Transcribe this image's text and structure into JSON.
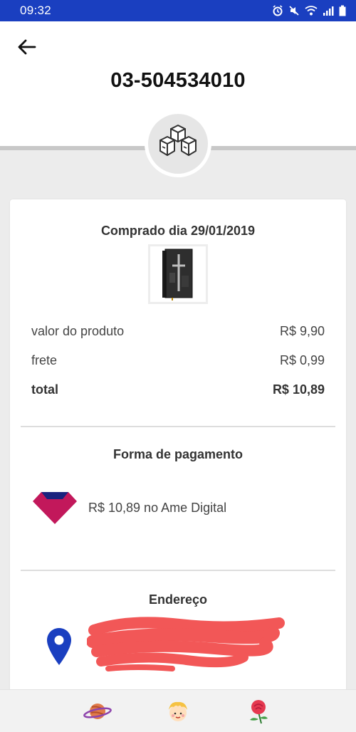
{
  "status_bar": {
    "time": "09:32",
    "icons": [
      "alarm-icon",
      "mute-icon",
      "wifi-icon",
      "signal-icon",
      "battery-icon"
    ]
  },
  "header": {
    "order_number": "03-504534010",
    "back_icon": "arrow-left-icon",
    "badge_icon": "boxes-icon"
  },
  "order": {
    "purchase_date": "Comprado dia 29/01/2019",
    "product_image": "book-cover-thumbnail",
    "rows": [
      {
        "label": "valor do produto",
        "value": "R$ 9,90"
      },
      {
        "label": "frete",
        "value": "R$ 0,99"
      },
      {
        "label": "total",
        "value": "R$ 10,89"
      }
    ]
  },
  "payment": {
    "title": "Forma de pagamento",
    "description": "R$ 10,89 no Ame Digital",
    "icon": "ame-digital-logo"
  },
  "address": {
    "title": "Endereço",
    "icon": "map-pin-icon",
    "lines": [
      "",
      "",
      ""
    ]
  },
  "bottom_nav": {
    "items": [
      "planet-icon",
      "child-avatar-icon",
      "rose-icon"
    ]
  },
  "colors": {
    "status_bar": "#1a3fc0",
    "ame_logo": "#c2185b",
    "map_pin": "#1a3fc0",
    "redaction": "#f25757"
  }
}
